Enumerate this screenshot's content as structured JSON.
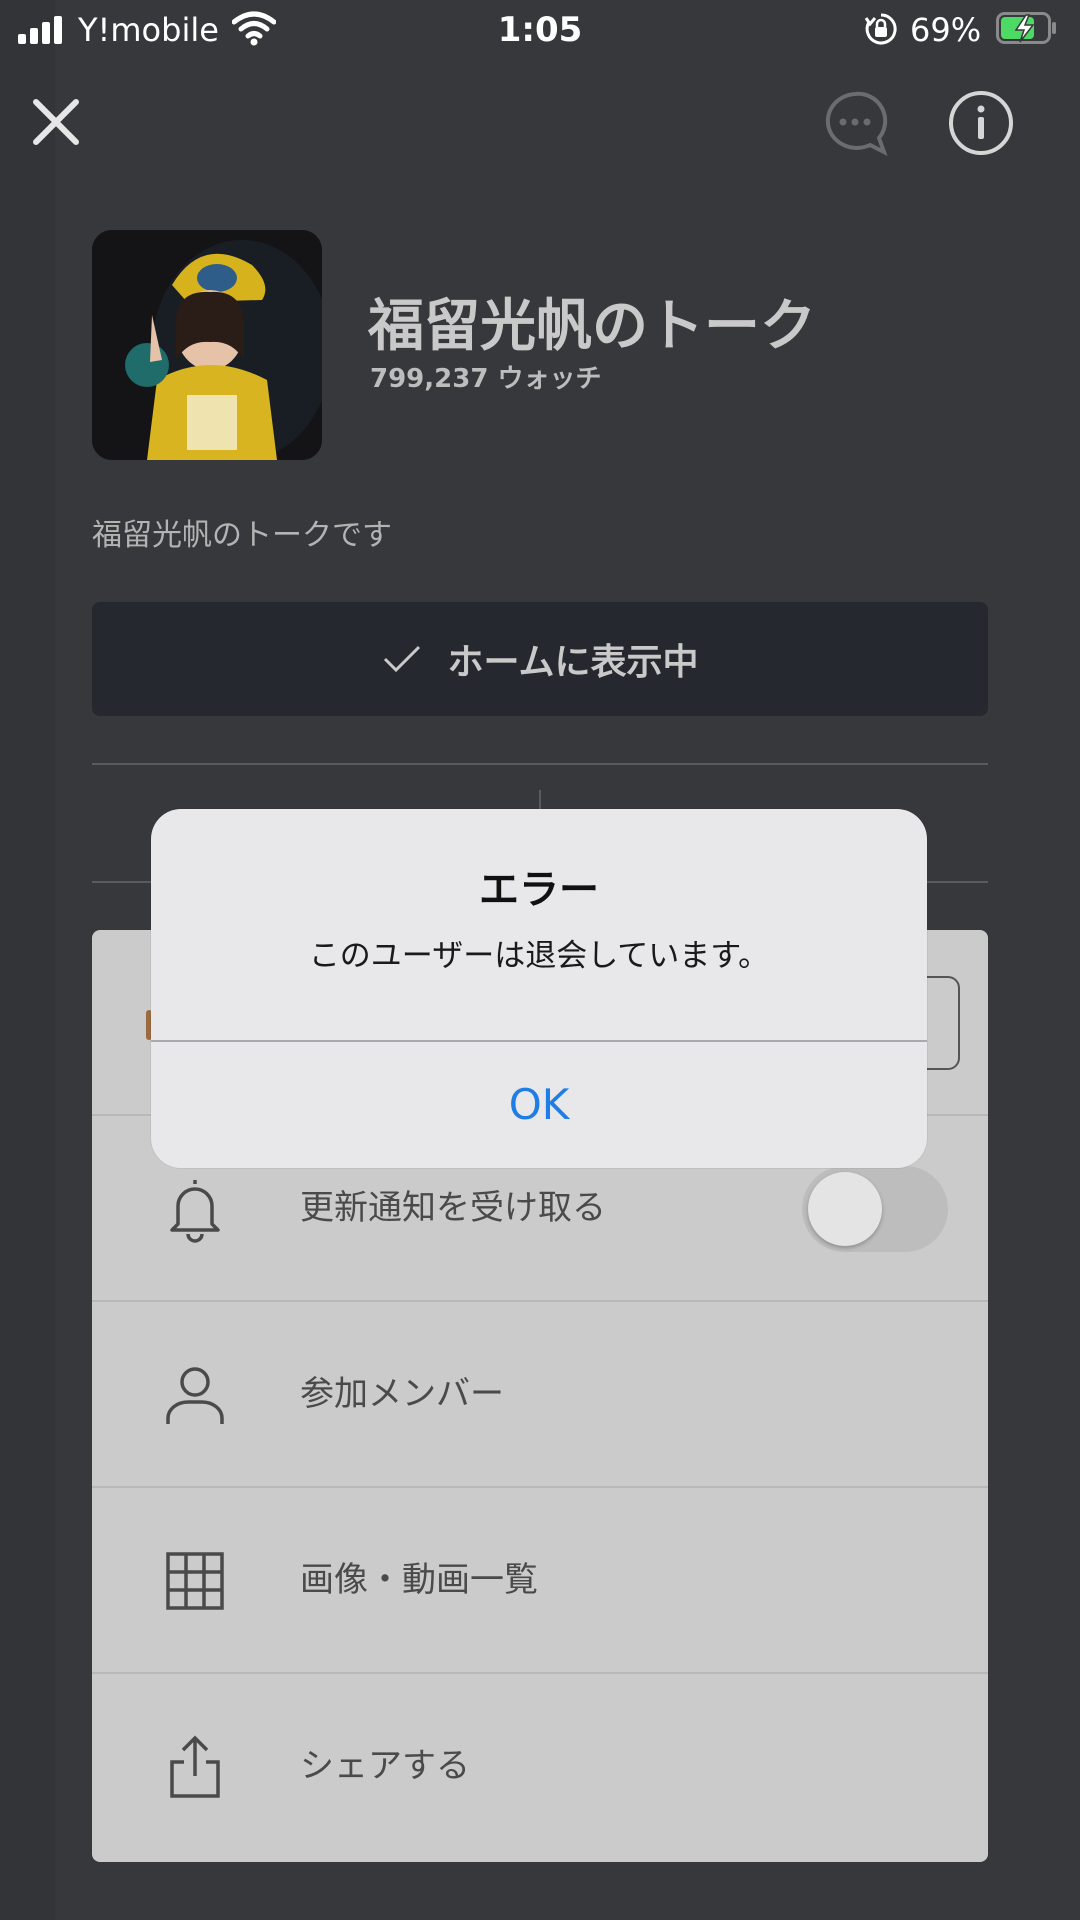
{
  "status_bar": {
    "carrier": "Y!mobile",
    "time": "1:05",
    "battery_percent": "69%"
  },
  "header": {
    "close_icon": "close-icon",
    "chat_icon": "chat-bubble-icon",
    "info_icon": "info-icon"
  },
  "profile": {
    "title": "福留光帆のトーク",
    "watch_count": "799,237 ウォッチ",
    "description": "福留光帆のトークです",
    "home_button_label": "ホームに表示中"
  },
  "menu": {
    "items": [
      {
        "label": "",
        "icon": "unknown"
      },
      {
        "label": "更新通知を受け取る",
        "icon": "bell-icon",
        "toggle_on": false
      },
      {
        "label": "参加メンバー",
        "icon": "person-icon"
      },
      {
        "label": "画像・動画一覧",
        "icon": "grid-icon"
      },
      {
        "label": "シェアする",
        "icon": "share-icon"
      }
    ]
  },
  "alert": {
    "title": "エラー",
    "message": "このユーザーは退会しています。",
    "ok_label": "OK"
  },
  "colors": {
    "background": "#37383b",
    "alert_button": "#1f7ee6",
    "battery_charging": "#4cd964"
  }
}
